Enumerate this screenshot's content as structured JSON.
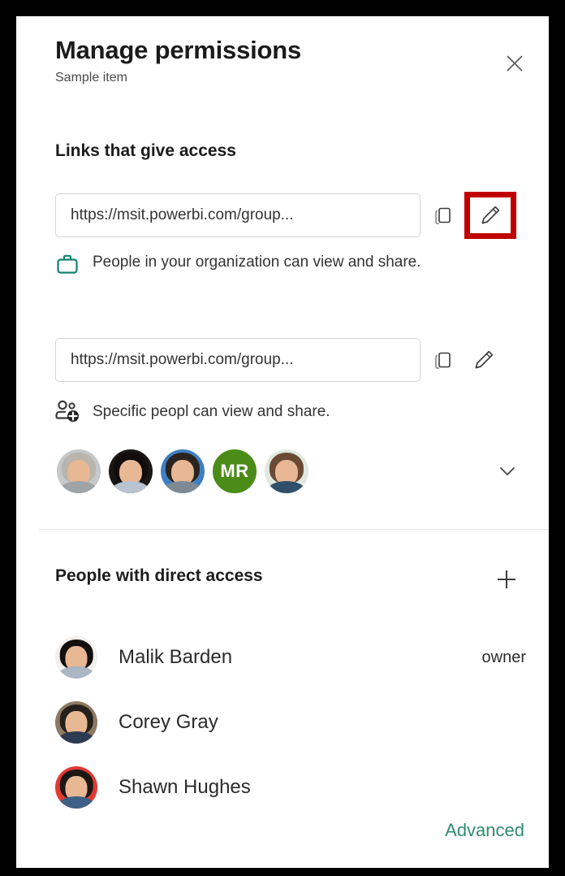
{
  "dialog": {
    "title": "Manage permissions",
    "subtitle": "Sample item",
    "close_label": "Close"
  },
  "links_section": {
    "heading": "Links that give access",
    "links": [
      {
        "url": "https://msit.powerbi.com/group...",
        "description": "People in your organization can view and share.",
        "icon": "briefcase-icon",
        "icon_color": "#128272",
        "copy_label": "Copy link",
        "edit_label": "Edit link",
        "edit_highlighted": true
      },
      {
        "url": "https://msit.powerbi.com/group...",
        "description": "Specific peopl can view and share.",
        "icon": "people-add-icon",
        "icon_color": "#3b3b3b",
        "copy_label": "Copy link",
        "edit_label": "Edit link",
        "edit_highlighted": false
      }
    ],
    "shared_avatars": [
      {
        "type": "photo",
        "hair": "#b9b4ad",
        "bg": "#c4c8c9",
        "body": "#9ea3a6"
      },
      {
        "type": "photo",
        "hair": "#100d0c",
        "bg": "#1b1614",
        "body": "#b9c3d1"
      },
      {
        "type": "photo",
        "hair": "#2b2320",
        "bg": "#3f7fc1",
        "body": "#7d8a93"
      },
      {
        "type": "initials",
        "initials": "MR",
        "bg": "#4b8c19"
      },
      {
        "type": "photo",
        "hair": "#6b4a35",
        "bg": "#dfe9de",
        "body": "#2f4f6b"
      }
    ],
    "expand_label": "Show more"
  },
  "people_section": {
    "heading": "People with direct access",
    "add_label": "Add people",
    "people": [
      {
        "name": "Malik Barden",
        "role": "owner",
        "hair": "#14100e",
        "bg": "#f2efec",
        "body": "#aab6c4"
      },
      {
        "name": "Corey Gray",
        "role": "",
        "hair": "#26201c",
        "bg": "#8e7a63",
        "body": "#2c3b52"
      },
      {
        "name": "Shawn Hughes",
        "role": "",
        "hair": "#1d1714",
        "bg": "#e03a33",
        "body": "#3f5f86"
      }
    ],
    "advanced_label": "Advanced"
  },
  "colors": {
    "highlight_box": "#c00000",
    "accent_green": "#2e8b6e",
    "link_icon_teal": "#128272",
    "initials_green": "#4b8c19"
  }
}
